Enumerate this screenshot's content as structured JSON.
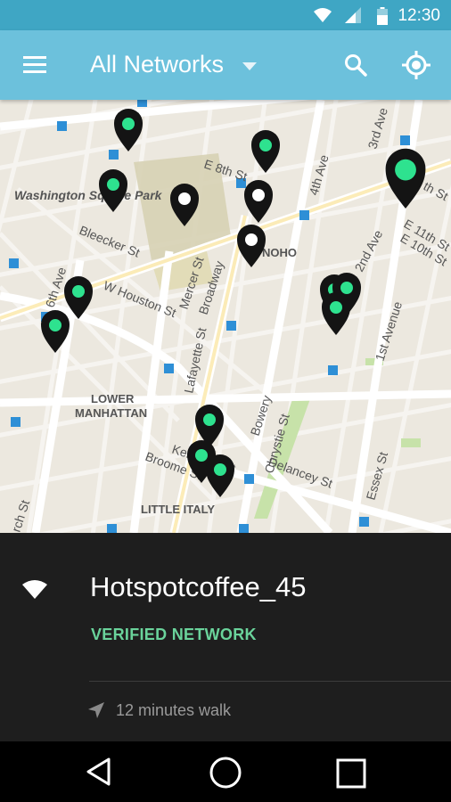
{
  "status_bar": {
    "time": "12:30"
  },
  "app_bar": {
    "title": "All Networks"
  },
  "map": {
    "labels": {
      "washington_square_park": "Washington Square Park",
      "bleecker_st": "Bleecker St",
      "w_houston_st": "W Houston St",
      "sixth_ave": "6th Ave",
      "mercer_st": "Mercer St",
      "broadway": "Broadway",
      "lafayette_st": "Lafayette St",
      "bowery": "Bowery",
      "chrystie_st": "Chrystie St",
      "delancey_st": "Delancey St",
      "essex_st": "Essex St",
      "kenmare_st": "Kenmare St",
      "broome_st": "Broome St",
      "e_8th_st": "E 8th St",
      "fourth_ave": "4th Ave",
      "third_ave": "3rd Ave",
      "second_ave": "2nd Ave",
      "first_avenue": "1st Avenue",
      "e_11th_st": "E 11th St",
      "e_10th_st": "E 10th St",
      "e_9th_st": "th St",
      "noho": "NOHO",
      "lower_manhattan_1": "LOWER",
      "lower_manhattan_2": "MANHATTAN",
      "little_italy": "LITTLE ITALY",
      "church_st": "rch St"
    },
    "pin_colors": {
      "verified": "#2ee28f",
      "open": "#ffffff",
      "pin_body": "#141414"
    }
  },
  "network_panel": {
    "name": "Hotspotcoffee_45",
    "status": "VERIFIED NETWORK",
    "walk_time": "12 minutes walk"
  }
}
